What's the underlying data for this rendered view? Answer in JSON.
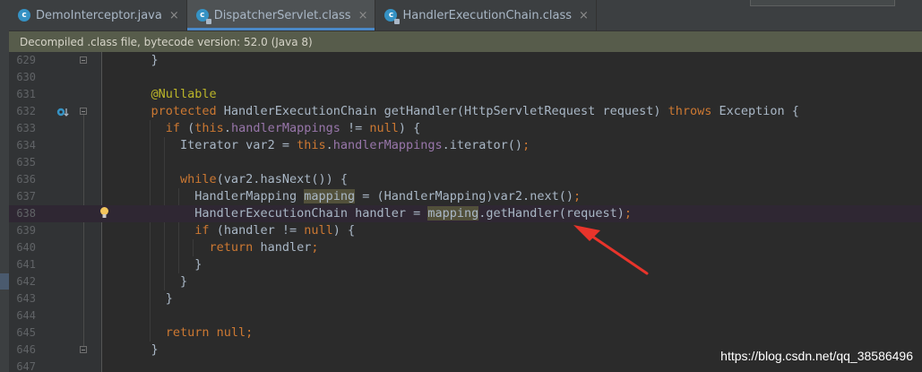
{
  "tabs": [
    {
      "label": "DemoInterceptor.java",
      "icon": "class-icon",
      "active": false
    },
    {
      "label": "DispatcherServlet.class",
      "icon": "class-readonly-icon",
      "active": true
    },
    {
      "label": "HandlerExecutionChain.class",
      "icon": "class-readonly-icon",
      "active": false
    }
  ],
  "tab_close_glyph": "×",
  "banner": "Decompiled .class file, bytecode version: 52.0 (Java 8)",
  "lines": [
    {
      "n": "629",
      "indent": 8,
      "tokens": [
        {
          "t": "}"
        }
      ]
    },
    {
      "n": "630",
      "indent": 0,
      "tokens": []
    },
    {
      "n": "631",
      "indent": 8,
      "tokens": [
        {
          "t": "@Nullable",
          "c": "ann"
        }
      ]
    },
    {
      "n": "632",
      "indent": 8,
      "tokens": [
        {
          "t": "protected",
          "c": "kw"
        },
        {
          "t": " HandlerExecutionChain getHandler(HttpServletRequest request) "
        },
        {
          "t": "throws",
          "c": "kw"
        },
        {
          "t": " Exception {"
        }
      ]
    },
    {
      "n": "633",
      "indent": 12,
      "tokens": [
        {
          "t": "if",
          "c": "kw"
        },
        {
          "t": " ("
        },
        {
          "t": "this",
          "c": "kw"
        },
        {
          "t": "."
        },
        {
          "t": "handlerMappings",
          "c": "fld"
        },
        {
          "t": " != "
        },
        {
          "t": "null",
          "c": "kw"
        },
        {
          "t": ") {"
        }
      ]
    },
    {
      "n": "634",
      "indent": 16,
      "tokens": [
        {
          "t": "Iterator var2 = "
        },
        {
          "t": "this",
          "c": "kw"
        },
        {
          "t": "."
        },
        {
          "t": "handlerMappings",
          "c": "fld"
        },
        {
          "t": ".iterator()"
        },
        {
          "t": ";",
          "c": "kw"
        }
      ]
    },
    {
      "n": "635",
      "indent": 0,
      "tokens": []
    },
    {
      "n": "636",
      "indent": 16,
      "tokens": [
        {
          "t": "while",
          "c": "kw"
        },
        {
          "t": "(var2.hasNext()) {"
        }
      ]
    },
    {
      "n": "637",
      "indent": 20,
      "tokens": [
        {
          "t": "HandlerMapping "
        },
        {
          "t": "mapping",
          "c": "occ"
        },
        {
          "t": " = (HandlerMapping)var2.next()"
        },
        {
          "t": ";",
          "c": "kw"
        }
      ]
    },
    {
      "n": "638",
      "indent": 20,
      "tokens": [
        {
          "t": "HandlerExecutionChain handler = "
        },
        {
          "t": "mapping",
          "c": "occ"
        },
        {
          "t": ".getHandler(request)"
        },
        {
          "t": ";",
          "c": "kw"
        }
      ]
    },
    {
      "n": "639",
      "indent": 20,
      "tokens": [
        {
          "t": "if",
          "c": "kw"
        },
        {
          "t": " (handler != "
        },
        {
          "t": "null",
          "c": "kw"
        },
        {
          "t": ") {"
        }
      ]
    },
    {
      "n": "640",
      "indent": 24,
      "tokens": [
        {
          "t": "return",
          "c": "kw"
        },
        {
          "t": " handler"
        },
        {
          "t": ";",
          "c": "kw"
        }
      ]
    },
    {
      "n": "641",
      "indent": 20,
      "tokens": [
        {
          "t": "}"
        }
      ]
    },
    {
      "n": "642",
      "indent": 16,
      "tokens": [
        {
          "t": "}"
        }
      ]
    },
    {
      "n": "643",
      "indent": 12,
      "tokens": [
        {
          "t": "}"
        }
      ]
    },
    {
      "n": "644",
      "indent": 0,
      "tokens": []
    },
    {
      "n": "645",
      "indent": 12,
      "tokens": [
        {
          "t": "return null",
          "c": "kw"
        },
        {
          "t": ";",
          "c": "kw"
        }
      ]
    },
    {
      "n": "646",
      "indent": 8,
      "tokens": [
        {
          "t": "}"
        }
      ]
    },
    {
      "n": "647",
      "indent": 0,
      "tokens": []
    }
  ],
  "current_line": "638",
  "gutter_icons": [
    {
      "line": "632",
      "icon": "overrides-method-icon"
    },
    {
      "line": "638",
      "icon": "lightbulb-icon"
    }
  ],
  "fold_markers": [
    "629",
    "632",
    "646"
  ],
  "annotation_arrow": {
    "points_to": "getHandler",
    "color": "#e8342b"
  },
  "watermark": "https://blog.csdn.net/qq_38586496",
  "colors": {
    "background": "#2b2b2b",
    "keyword": "#cc7832",
    "annotation": "#bbb529",
    "field": "#9876aa",
    "text": "#a9b7c6",
    "line_number": "#606366",
    "banner_bg": "#575c4b",
    "tab_accent": "#4a88c7"
  }
}
